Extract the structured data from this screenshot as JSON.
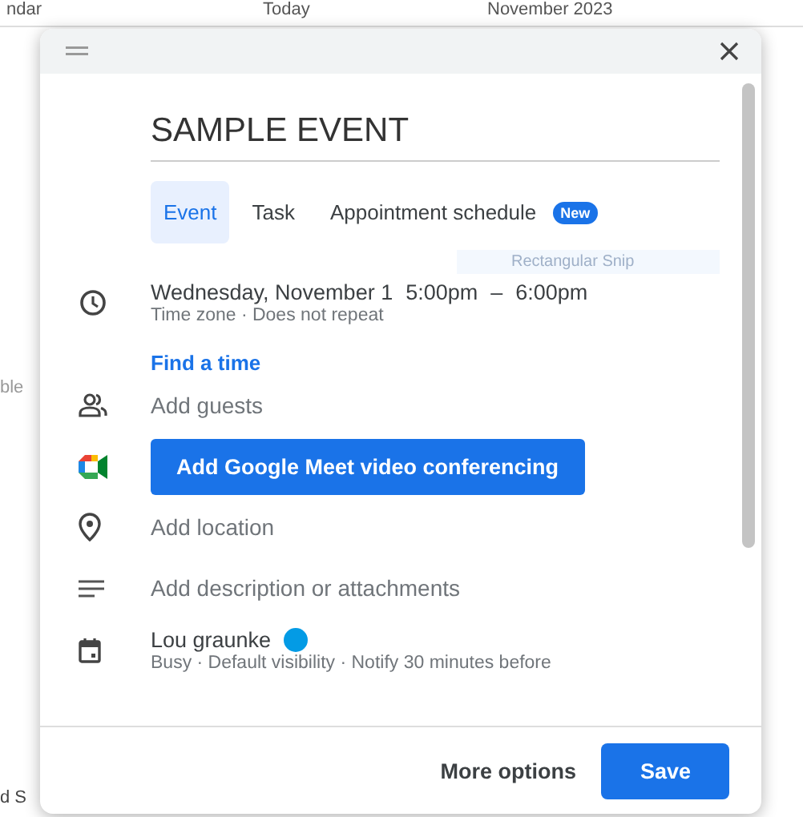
{
  "background": {
    "header_texts": [
      "ndar",
      "Today",
      "November 2023"
    ],
    "side_texts": [
      "ble",
      "d S"
    ]
  },
  "dialog": {
    "title": "SAMPLE EVENT",
    "tabs": [
      {
        "label": "Event",
        "selected": true
      },
      {
        "label": "Task",
        "selected": false
      },
      {
        "label": "Appointment schedule",
        "selected": false,
        "badge": "New"
      }
    ],
    "tooltip": "Rectangular Snip",
    "datetime": {
      "date": "Wednesday, November 1",
      "start": "5:00pm",
      "dash": "–",
      "end": "6:00pm",
      "details": "Time zone · Does not repeat"
    },
    "find_time": "Find a time",
    "rows": [
      {
        "kind": "guests",
        "text": "Add guests"
      },
      {
        "kind": "conference",
        "text": "Add Google Meet video conferencing"
      },
      {
        "kind": "location",
        "text": "Add location"
      },
      {
        "kind": "description",
        "text": "Add description or attachments"
      },
      {
        "kind": "calendar",
        "text": "Lou graunke",
        "color": "#039be5",
        "details": "Busy · Default visibility · Notify 30 minutes before"
      }
    ],
    "buttons": [
      "More options",
      "Save"
    ]
  }
}
